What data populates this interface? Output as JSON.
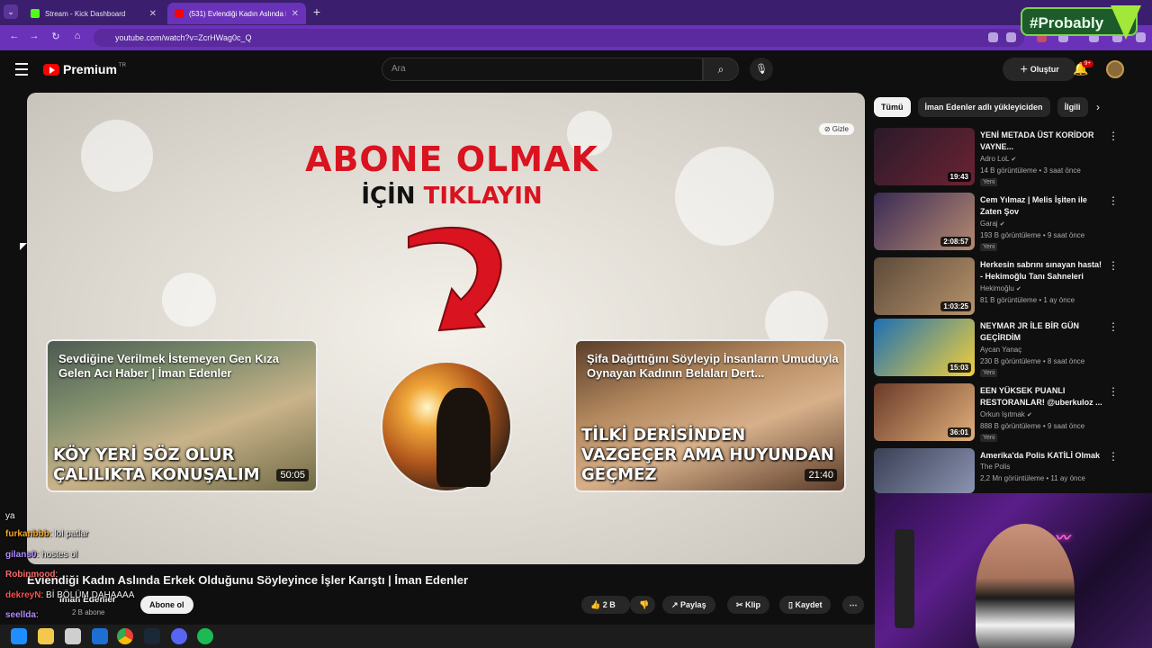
{
  "browser": {
    "tabs": [
      {
        "label": "Stream - Kick Dashboard",
        "favicon_color": "#53fc18"
      },
      {
        "label": "(531) Evlendiği Kadın Aslında E",
        "favicon_color": "#ff0000"
      }
    ],
    "new_tab_icon": "plus",
    "url": "youtube.com/watch?v=ZcrHWag0c_Q"
  },
  "overlay_brand": "#Probably",
  "youtube": {
    "logo_text": "Premium",
    "logo_sup": "TR",
    "search_placeholder": "Ara",
    "create_label": "Oluştur",
    "notification_count": "9+"
  },
  "player": {
    "hide_label": "Gizle",
    "headline_line1": "ABONE OLMAK",
    "headline_line2_a": "İÇİN",
    "headline_line2_b": "TIKLAYIN",
    "endcards": [
      {
        "title": "Sevdiğine Verilmek İstemeyen Gen Kıza Gelen Acı Haber | İman Edenler",
        "big_text": "KÖY YERİ SÖZ OLUR ÇALILIKTA KONUŞALIM",
        "duration": "50:05"
      },
      {
        "title": "Şifa Dağıttığını Söyleyip İnsanların Umuduyla Oynayan Kadının Belaları Dert...",
        "big_text": "TİLKİ DERİSİNDEN VAZGEÇER AMA HUYUNDAN GEÇMEZ",
        "duration": "21:40"
      }
    ]
  },
  "video": {
    "title": "Evlendiği Kadın Aslında Erkek Olduğunu Söyleyince İşler Karıştı | İman Edenler",
    "channel": "İman Edenler",
    "subscribers": "2 B abone",
    "subscribe_label": "Abone ol",
    "likes": "2 B",
    "share_label": "Paylaş",
    "clip_label": "Klip",
    "save_label": "Kaydet"
  },
  "chat": [
    {
      "user": "",
      "text": "ya",
      "color": "#ffffff"
    },
    {
      "user": "furkanbbb",
      "text": ": lol patlar",
      "color": "#f5a623"
    },
    {
      "user": "gilans0",
      "text": ": hostes ol",
      "color": "#b38bff"
    },
    {
      "user": "Robinmood",
      "text": ":",
      "color": "#ff6b6b"
    },
    {
      "user": "dekreyN",
      "text": ": Bİ BÖLÜM DAHAAAA",
      "color": "#ff4f4f"
    },
    {
      "user": "seellda",
      "text": ":",
      "color": "#b38bff"
    }
  ],
  "chips": [
    "Tümü",
    "İman Edenler adlı yükleyiciden",
    "İlgili"
  ],
  "recommendations": [
    {
      "title": "YENİ METADA ÜST KORİDOR VAYNE...",
      "channel": "Adro LoL",
      "views": "14 B görüntüleme",
      "age": "3 saat önce",
      "new": "Yeni",
      "duration": "19:43",
      "thumb_a": "#2a1a2a",
      "thumb_b": "#6b2333"
    },
    {
      "title": "Cem Yılmaz | Melis İşiten ile Zaten Şov",
      "channel": "Garaj",
      "views": "193 B görüntüleme",
      "age": "9 saat önce",
      "new": "Yeni",
      "duration": "2:08:57",
      "thumb_a": "#3a2a55",
      "thumb_b": "#b58a70"
    },
    {
      "title": "Herkesin sabrını sınayan hasta! - Hekimoğlu Tanı Sahneleri",
      "channel": "Hekimoğlu",
      "views": "81 B görüntüleme",
      "age": "1 ay önce",
      "new": "",
      "duration": "1:03:25",
      "thumb_a": "#5c4a3a",
      "thumb_b": "#b7936b"
    },
    {
      "title": "NEYMAR JR İLE BİR GÜN GEÇİRDİM",
      "channel": "Aycan Yanaç",
      "views": "230 B görüntüleme",
      "age": "8 saat önce",
      "new": "Yeni",
      "duration": "15:03",
      "thumb_a": "#1c6fb5",
      "thumb_b": "#f2d03a"
    },
    {
      "title": "EEN YÜKSEK PUANLI RESTORANLAR! @uberkuloz ...",
      "channel": "Orkun Işıtmak",
      "views": "888 B görüntüleme",
      "age": "9 saat önce",
      "new": "Yeni",
      "duration": "36:01",
      "thumb_a": "#6b3a2a",
      "thumb_b": "#e0b07a"
    },
    {
      "title": "Amerika'da Polis KATİLİ Olmak",
      "channel": "The Polis",
      "views": "2,2 Mn görüntüleme",
      "age": "11 ay önce",
      "new": "",
      "duration": "",
      "thumb_a": "#3a3f55",
      "thumb_b": "#8a93b0"
    }
  ],
  "colors": {
    "tabbar": "#3b1f6e",
    "addressbar": "#6a32b8",
    "yt_bg": "#0f0f0f",
    "red": "#d9131f"
  }
}
